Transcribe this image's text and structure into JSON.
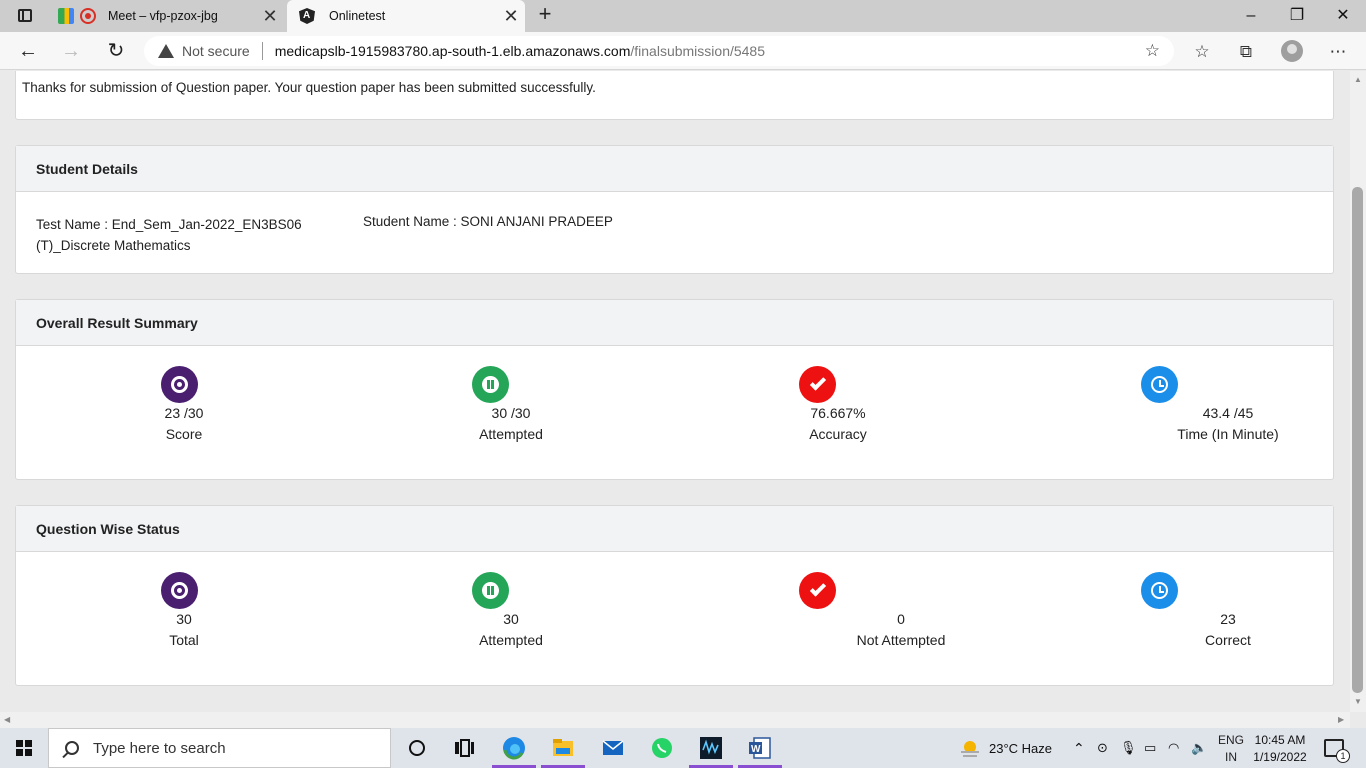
{
  "browser": {
    "tabs": [
      {
        "label": "Meet – vfp-pzox-jbg",
        "icon": "google-meet-icon"
      },
      {
        "label": "Onlinetest",
        "icon": "angular-icon"
      }
    ],
    "security_label": "Not secure",
    "url_host": "medicapslb-1915983780.ap-south-1.elb.amazonaws.com",
    "url_path": "/finalsubmission/5485"
  },
  "page": {
    "thanks_message": "Thanks for submission of Question paper. Your question paper has been submitted successfully.",
    "student_details": {
      "heading": "Student Details",
      "test_name": "Test Name : End_Sem_Jan-2022_EN3BS06 (T)_Discrete Mathematics",
      "student_name": "Student Name : SONI ANJANI PRADEEP"
    },
    "overall_summary": {
      "heading": "Overall Result Summary",
      "items": [
        {
          "value": "23 /30",
          "label": "Score",
          "icon": "target-icon",
          "color": "#4a1f6f"
        },
        {
          "value": "30 /30",
          "label": "Attempted",
          "icon": "pause-icon",
          "color": "#25a558"
        },
        {
          "value": "76.667%",
          "label": "Accuracy",
          "icon": "check-icon",
          "color": "#ee1111"
        },
        {
          "value": "43.4 /45",
          "label": "Time (In Minute)",
          "icon": "clock-icon",
          "color": "#1b8ee9"
        }
      ]
    },
    "question_status": {
      "heading": "Question Wise Status",
      "items": [
        {
          "value": "30",
          "label": "Total",
          "icon": "target-icon",
          "color": "#4a1f6f"
        },
        {
          "value": "30",
          "label": "Attempted",
          "icon": "pause-icon",
          "color": "#25a558"
        },
        {
          "value": "0",
          "label": "Not Attempted",
          "icon": "check-icon",
          "color": "#ee1111"
        },
        {
          "value": "23",
          "label": "Correct",
          "icon": "clock-icon",
          "color": "#1b8ee9"
        }
      ]
    }
  },
  "taskbar": {
    "search_placeholder": "Type here to search",
    "weather": "23°C  Haze",
    "lang_top": "ENG",
    "lang_bottom": "IN",
    "time": "10:45 AM",
    "date": "1/19/2022",
    "notification_count": "1"
  }
}
